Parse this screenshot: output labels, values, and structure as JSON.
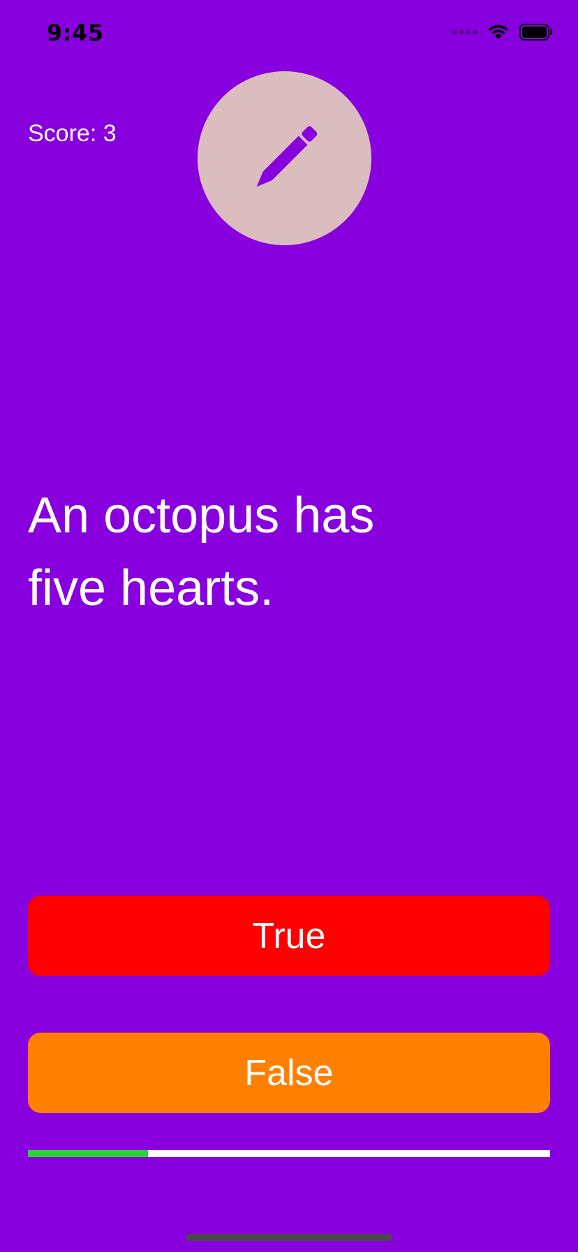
{
  "status_bar": {
    "time": "9:45",
    "icons": [
      "signal-icon",
      "wifi-icon",
      "battery-icon"
    ]
  },
  "score": {
    "label": "Score: 3"
  },
  "avatar": {
    "icon": "pencil-icon",
    "background": "#dbbcbf",
    "icon_color": "#8800dd"
  },
  "question": {
    "text": "An octopus has five hearts."
  },
  "answers": {
    "true_label": "True",
    "false_label": "False",
    "true_color": "#ff0000",
    "false_color": "#ff8000"
  },
  "progress": {
    "fraction": 0.23,
    "fill_color": "#2fd335",
    "track_color": "#ffffff"
  },
  "theme": {
    "background": "#8800dd"
  }
}
